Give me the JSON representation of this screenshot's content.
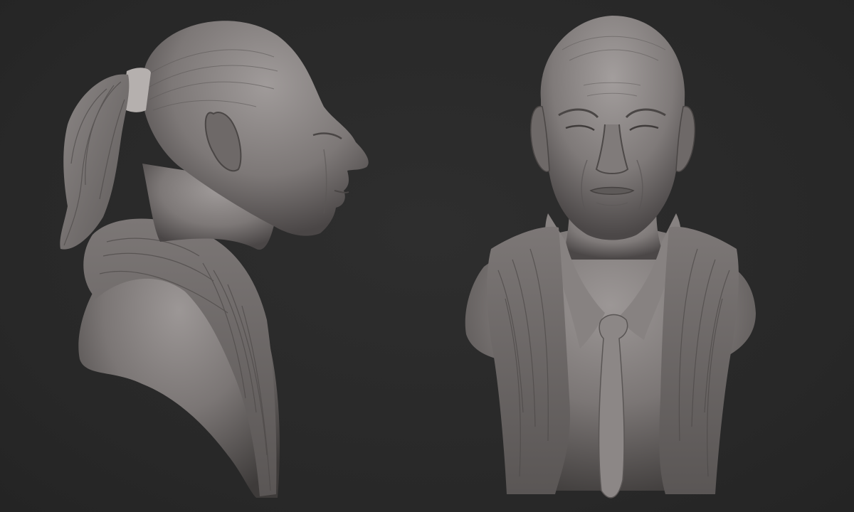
{
  "scene": {
    "background_color": "#2a2a2a",
    "clay_color": "#6f6a69",
    "views": [
      {
        "id": "side-view",
        "orientation": "profile-right"
      },
      {
        "id": "front-view",
        "orientation": "front"
      }
    ]
  }
}
